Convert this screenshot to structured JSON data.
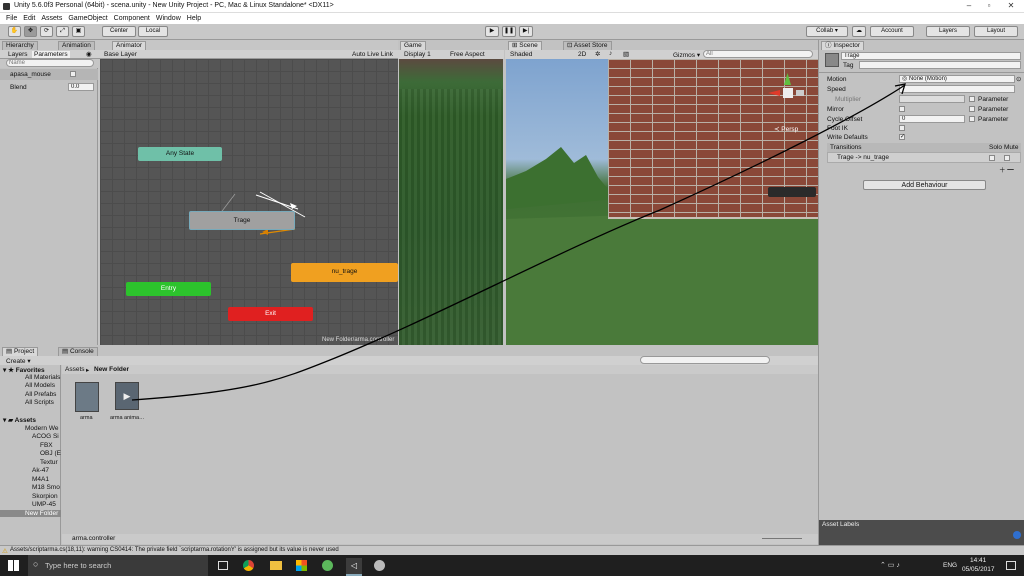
{
  "window": {
    "title": "Unity 5.6.0f3 Personal (64bit) - scena.unity - New Unity Project - PC, Mac & Linux Standalone* <DX11>"
  },
  "menu": [
    "File",
    "Edit",
    "Assets",
    "GameObject",
    "Component",
    "Window",
    "Help"
  ],
  "toolbar": {
    "center": "Center",
    "local": "Local",
    "collab": "Collab ▾",
    "account": "Account",
    "layers": "Layers",
    "layout": "Layout"
  },
  "tabs": {
    "hierarchy": "Hierarchy",
    "animation": "Animation",
    "animator": "Animator",
    "game": "Game",
    "scene": "Scene",
    "asset_store": "Asset Store",
    "inspector": "Inspector",
    "project": "Project",
    "console": "Console"
  },
  "animator": {
    "layers_tab": "Layers",
    "parameters_tab": "Parameters",
    "base_layer": "Base Layer",
    "auto_live_link": "Auto Live Link",
    "search_placeholder": "Name",
    "params": [
      {
        "name": "apasa_mouse",
        "value": ""
      },
      {
        "name": "Blend",
        "value": "0.0"
      }
    ],
    "states": {
      "any": "Any State",
      "trage": "Trage",
      "nu_trage": "nu_trage",
      "entry": "Entry",
      "exit": "Exit"
    },
    "footer_path": "New Folder/arma.controller"
  },
  "game": {
    "display": "Display 1",
    "aspect": "Free Aspect"
  },
  "scene": {
    "shading": "Shaded",
    "mode_2d": "2D",
    "gizmos": "Gizmos ▾",
    "search": "All",
    "persp": "Persp"
  },
  "inspector": {
    "name": "Trage",
    "tag_label": "Tag",
    "motion_label": "Motion",
    "motion_value": "None (Motion)",
    "speed": "Speed",
    "multiplier": "Multiplier",
    "parameter": "Parameter",
    "mirror": "Mirror",
    "cycle_offset": "Cycle Offset",
    "cycle_value": "0",
    "foot_ik": "Foot IK",
    "write_defaults": "Write Defaults",
    "transitions": "Transitions",
    "solo": "Solo",
    "mute": "Mute",
    "transition_item": "Trage -> nu_trage",
    "add_behaviour": "Add Behaviour",
    "asset_labels": "Asset Labels"
  },
  "project": {
    "create": "Create ▾",
    "breadcrumb_assets": "Assets",
    "breadcrumb_folder": "New Folder",
    "favorites": "Favorites",
    "fav_items": [
      "All Materials",
      "All Models",
      "All Prefabs",
      "All Scripts"
    ],
    "assets_root": "Assets",
    "tree": [
      "Modern We",
      "ACOG Si",
      "FBX",
      "OBJ (E",
      "Textur",
      "Ak-47",
      "M4A1",
      "M18 Smo",
      "Skorpion",
      "UMP-45",
      "New Folder"
    ],
    "files": [
      {
        "label": "arma"
      },
      {
        "label": "arma anima…"
      }
    ],
    "bottom_path": "arma.controller"
  },
  "status": {
    "warning": "Assets/scriptarma.cs(18,11): warning CS0414: The private field `scriptarma.rotationY' is assigned but its value is never used"
  },
  "taskbar": {
    "search": "Type here to search",
    "lang": "ENG",
    "time": "14:41",
    "date": "05/05/2017"
  }
}
